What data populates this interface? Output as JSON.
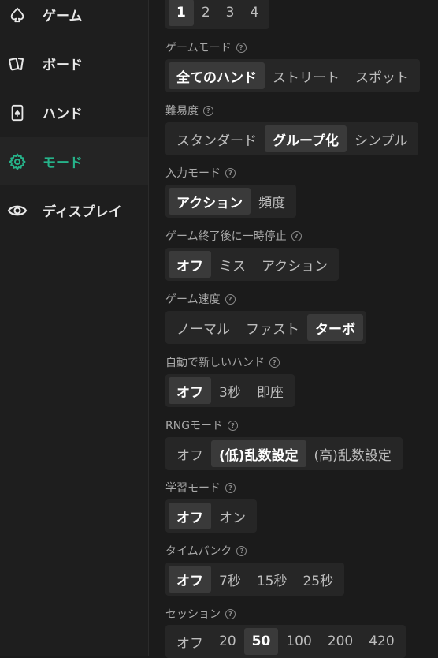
{
  "sidebar": {
    "items": [
      {
        "label": "ゲーム",
        "icon": "spade-icon"
      },
      {
        "label": "ボード",
        "icon": "cards-icon"
      },
      {
        "label": "ハンド",
        "icon": "card-spade-icon"
      },
      {
        "label": "モード",
        "icon": "gear-icon",
        "active": true
      },
      {
        "label": "ディスプレイ",
        "icon": "eye-icon"
      }
    ]
  },
  "accent_color": "#26b38a",
  "settings": {
    "players": {
      "options": [
        "1",
        "2",
        "3",
        "4"
      ],
      "selected": "1"
    },
    "game_mode": {
      "label": "ゲームモード",
      "options": [
        "全てのハンド",
        "ストリート",
        "スポット"
      ],
      "selected": "全てのハンド"
    },
    "difficulty": {
      "label": "難易度",
      "options": [
        "スタンダード",
        "グループ化",
        "シンプル"
      ],
      "selected": "グループ化"
    },
    "input_mode": {
      "label": "入力モード",
      "options": [
        "アクション",
        "頻度"
      ],
      "selected": "アクション"
    },
    "pause_after_game": {
      "label": "ゲーム終了後に一時停止",
      "options": [
        "オフ",
        "ミス",
        "アクション"
      ],
      "selected": "オフ"
    },
    "game_speed": {
      "label": "ゲーム速度",
      "options": [
        "ノーマル",
        "ファスト",
        "ターボ"
      ],
      "selected": "ターボ"
    },
    "auto_new_hand": {
      "label": "自動で新しいハンド",
      "options": [
        "オフ",
        "3秒",
        "即座"
      ],
      "selected": "オフ"
    },
    "rng_mode": {
      "label": "RNGモード",
      "options": [
        "オフ",
        "(低)乱数設定",
        "(高)乱数設定"
      ],
      "selected": "(低)乱数設定"
    },
    "learning_mode": {
      "label": "学習モード",
      "options": [
        "オフ",
        "オン"
      ],
      "selected": "オフ"
    },
    "time_bank": {
      "label": "タイムバンク",
      "options": [
        "オフ",
        "7秒",
        "15秒",
        "25秒"
      ],
      "selected": "オフ"
    },
    "session": {
      "label": "セッション",
      "options": [
        "オフ",
        "20",
        "50",
        "100",
        "200",
        "420"
      ],
      "selected": "50"
    }
  }
}
